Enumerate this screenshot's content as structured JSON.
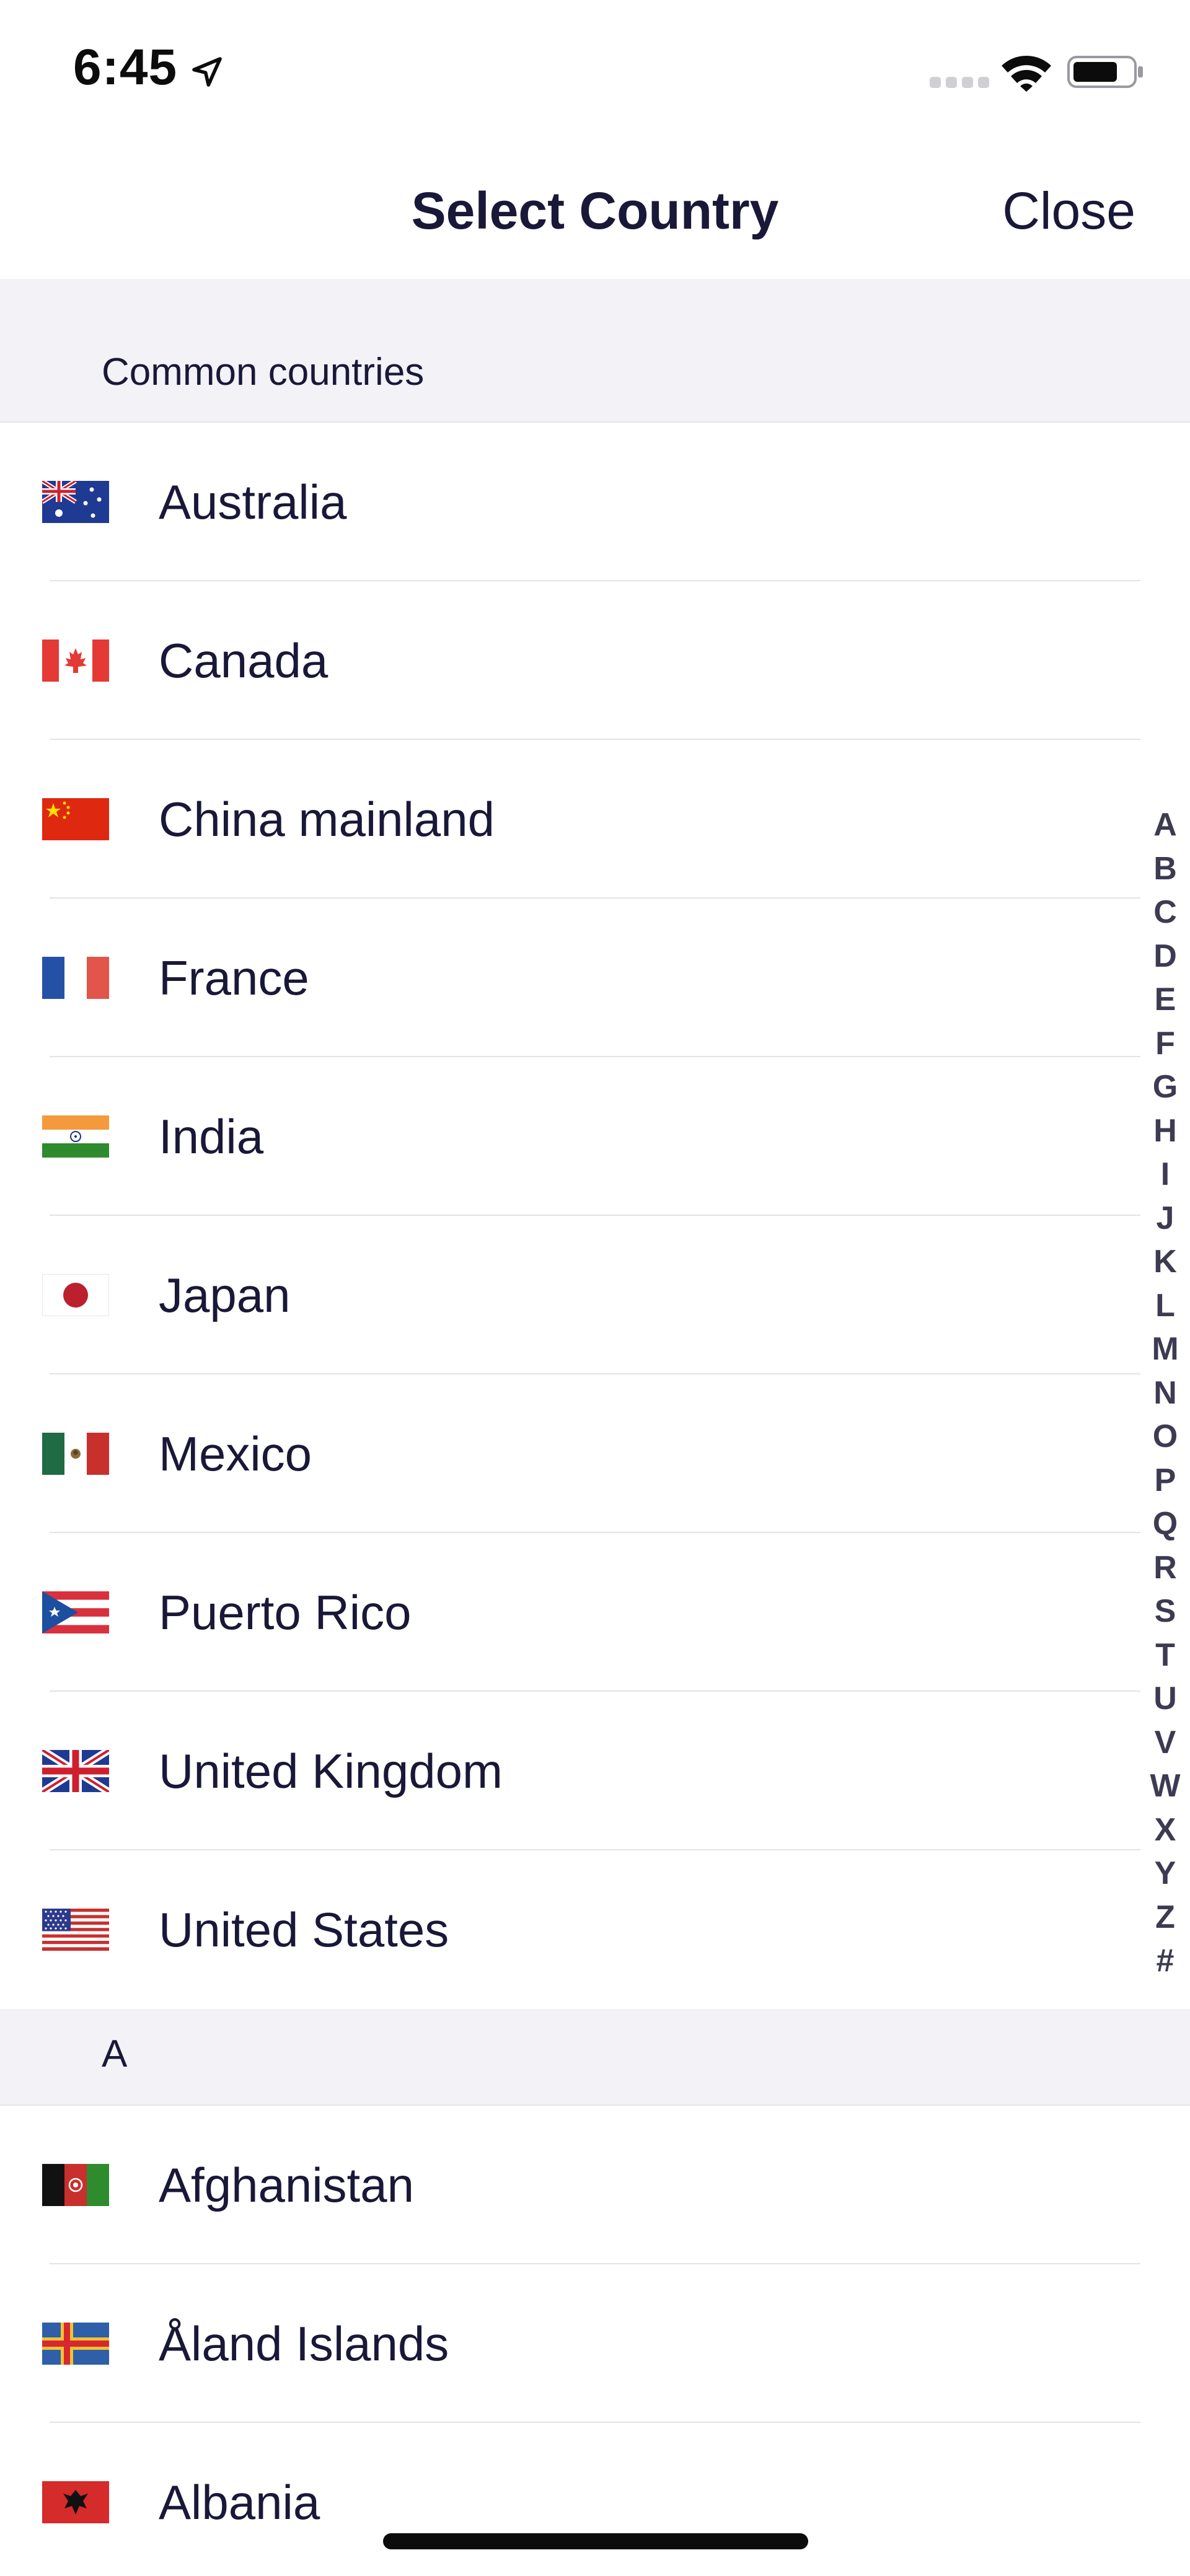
{
  "status_bar": {
    "time": "6:45"
  },
  "nav": {
    "title": "Select Country",
    "close_label": "Close"
  },
  "sections": {
    "common": {
      "header": "Common countries",
      "countries": [
        {
          "name": "Australia",
          "flag": "australia-flag"
        },
        {
          "name": "Canada",
          "flag": "canada-flag"
        },
        {
          "name": "China mainland",
          "flag": "china-flag"
        },
        {
          "name": "France",
          "flag": "france-flag"
        },
        {
          "name": "India",
          "flag": "india-flag"
        },
        {
          "name": "Japan",
          "flag": "japan-flag"
        },
        {
          "name": "Mexico",
          "flag": "mexico-flag"
        },
        {
          "name": "Puerto Rico",
          "flag": "puerto-rico-flag"
        },
        {
          "name": "United Kingdom",
          "flag": "united-kingdom-flag"
        },
        {
          "name": "United States",
          "flag": "united-states-flag"
        }
      ]
    },
    "a": {
      "header": "A",
      "countries": [
        {
          "name": "Afghanistan",
          "flag": "afghanistan-flag"
        },
        {
          "name": "Åland Islands",
          "flag": "aland-islands-flag"
        },
        {
          "name": "Albania",
          "flag": "albania-flag"
        }
      ]
    }
  },
  "alphabet_index": [
    "A",
    "B",
    "C",
    "D",
    "E",
    "F",
    "G",
    "H",
    "I",
    "J",
    "K",
    "L",
    "M",
    "N",
    "O",
    "P",
    "Q",
    "R",
    "S",
    "T",
    "U",
    "V",
    "W",
    "X",
    "Y",
    "Z",
    "#"
  ],
  "colors": {
    "text_primary": "#1a1838",
    "section_background": "#f2f2f7",
    "separator": "#e3e3e8"
  }
}
